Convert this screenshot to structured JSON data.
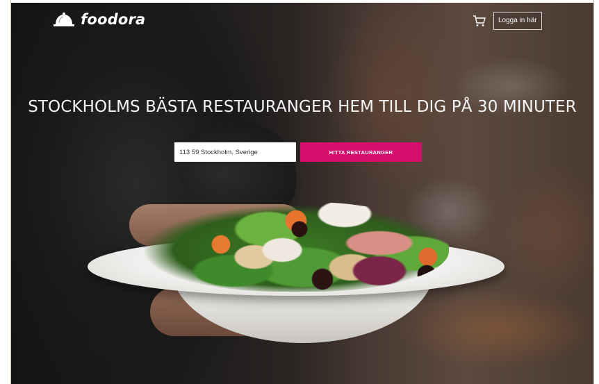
{
  "header": {
    "logo_text": "foodora",
    "logo_icon": "cloche-icon",
    "cart_icon": "cart-icon",
    "login_label": "Logga in här"
  },
  "hero": {
    "headline": "STOCKHOLMS BÄSTA RESTAURANGER HEM TILL DIG PÅ 30 MINUTER",
    "image_subject": "salad-plate"
  },
  "search": {
    "address_value": "113 59 Stockholm, Sverige",
    "button_label": "HITTA RESTAURANGER"
  },
  "colors": {
    "accent": "#d60f6f",
    "text_on_dark": "#ffffff"
  }
}
